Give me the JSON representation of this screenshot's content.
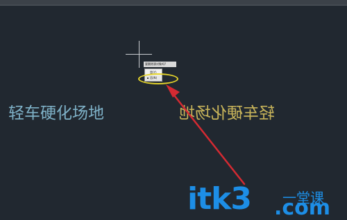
{
  "drawing": {
    "text_original": "轻车硬化场地",
    "text_mirrored": "轻车硬化场地"
  },
  "context_prompt": {
    "question": "要删除源对象吗?",
    "options": [
      "是(Y)",
      "否(N)"
    ],
    "selected_option": "否(N)"
  },
  "watermark": {
    "main": "itk3",
    "dot_com": ".com",
    "chinese": "一堂课"
  },
  "colors": {
    "canvas": "#212830",
    "original_text": "#7fb2c8",
    "mirrored_text": "#c8b45a",
    "highlight_ellipse": "#e5d42a",
    "annotation_arrow": "#d42a32",
    "watermark": "#1d8ee6"
  },
  "icons": {
    "cursor": "crosshair-icon",
    "selection_marker": "bullet-icon"
  }
}
